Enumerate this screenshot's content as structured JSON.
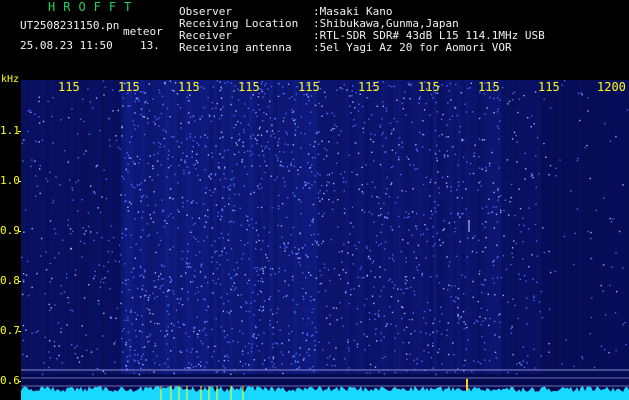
{
  "app": {
    "title": "HROFFT"
  },
  "meta": {
    "filename": "UT2508231150.pn",
    "datetime": "25.08.23 11:50",
    "type_label": "meteor",
    "count": "13."
  },
  "info": {
    "observer_label": "Observer",
    "observer_value": ":Masaki Kano",
    "location_label": "Receiving Location",
    "location_value": ":Shibukawa,Gunma,Japan",
    "receiver_label": "Receiver",
    "receiver_value": ":RTL-SDR SDR# 43dB L15 114.1MHz USB",
    "antenna_label": "Receiving antenna",
    "antenna_value": ":5el Yagi Az 20 for Aomori VOR"
  },
  "axes": {
    "unit": "kHz",
    "x_ticks": [
      "115",
      "115",
      "115",
      "115",
      "115",
      "115",
      "115",
      "115",
      "115",
      "1200"
    ],
    "y_ticks": [
      "1.1",
      "1.0",
      "0.9",
      "0.8",
      "0.7",
      "0.6"
    ]
  },
  "colors": {
    "background": "#000000",
    "label": "#ffff1a",
    "title": "#19d45a",
    "spectrogram_bg": "#050a4e",
    "noise": "#3f5cff",
    "signal": "#1ad2ff"
  }
}
